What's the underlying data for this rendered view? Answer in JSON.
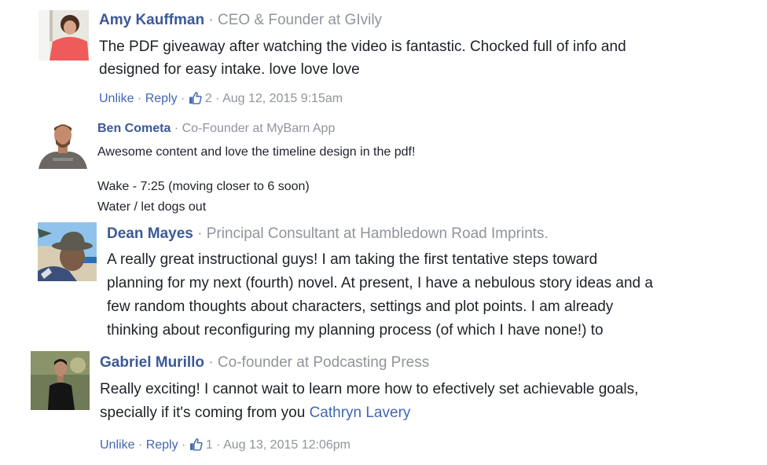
{
  "comments": [
    {
      "author": "Amy Kauffman",
      "separator": " · ",
      "job": "CEO & Founder at GIvily",
      "lines": [
        "The PDF giveaway after watching the video is fantastic. Chocked full of info and",
        "designed for easy intake. love love love"
      ],
      "actions": {
        "unlike": "Unlike",
        "reply": "Reply",
        "dot": " · ",
        "like_icon": "thumbs-up-icon",
        "like_count": "2",
        "timestamp": "Aug 12, 2015 9:15am"
      },
      "avatar_colors": {
        "bg": "#e8e6df",
        "shirt": "#ef5a5a",
        "hair": "#4a2e22",
        "skin": "#d9a588"
      }
    },
    {
      "author": "Ben Cometa",
      "separator": " · ",
      "job": "Co-Founder at MyBarn App",
      "lines": [
        "Awesome content and love the timeline design in the pdf!",
        "Wake - 7:25 (moving closer to 6 soon)",
        "Water / let dogs out"
      ],
      "avatar_colors": {
        "bg": "#ffffff",
        "shirt": "#6b6864",
        "hair": "#5b3d2a",
        "skin": "#c48c6c"
      }
    },
    {
      "author": "Dean Mayes",
      "separator": " · ",
      "job": "Principal Consultant at Hambledown Road Imprints.",
      "lines": [
        "A really great instructional guys! I am taking the first tentative steps toward",
        "planning for my next (fourth) novel. At present, I have a nebulous story ideas and a",
        "few random thoughts about characters, settings and plot points. I am already",
        "thinking about reconfiguring my planning process (of which I have none!) to"
      ],
      "avatar_colors": {
        "sky": "#8fc3ec",
        "sand": "#d8cdb2",
        "hat": "#5d5a4f",
        "skin": "#7a5c48",
        "shirt": "#3c4e7a"
      }
    },
    {
      "author": "Gabriel Murillo",
      "separator": " · ",
      "job": "Co-founder at Podcasting Press",
      "lines": [
        "Really exciting! I cannot wait to learn more how to efectively set achievable goals,",
        "specially if it's coming from you "
      ],
      "mention": "Cathryn Lavery",
      "actions": {
        "unlike": "Unlike",
        "reply": "Reply",
        "dot": " · ",
        "like_icon": "thumbs-up-icon",
        "like_count": "1",
        "timestamp": "Aug 13, 2015 12:06pm"
      },
      "avatar_colors": {
        "bg": "#6f7a56",
        "shirt": "#141414",
        "skin": "#b88a70",
        "hair": "#1b1410"
      }
    }
  ],
  "colors": {
    "author": "#3b5998",
    "link": "#4267b2",
    "meta": "#90949c",
    "text": "#1d2129"
  }
}
